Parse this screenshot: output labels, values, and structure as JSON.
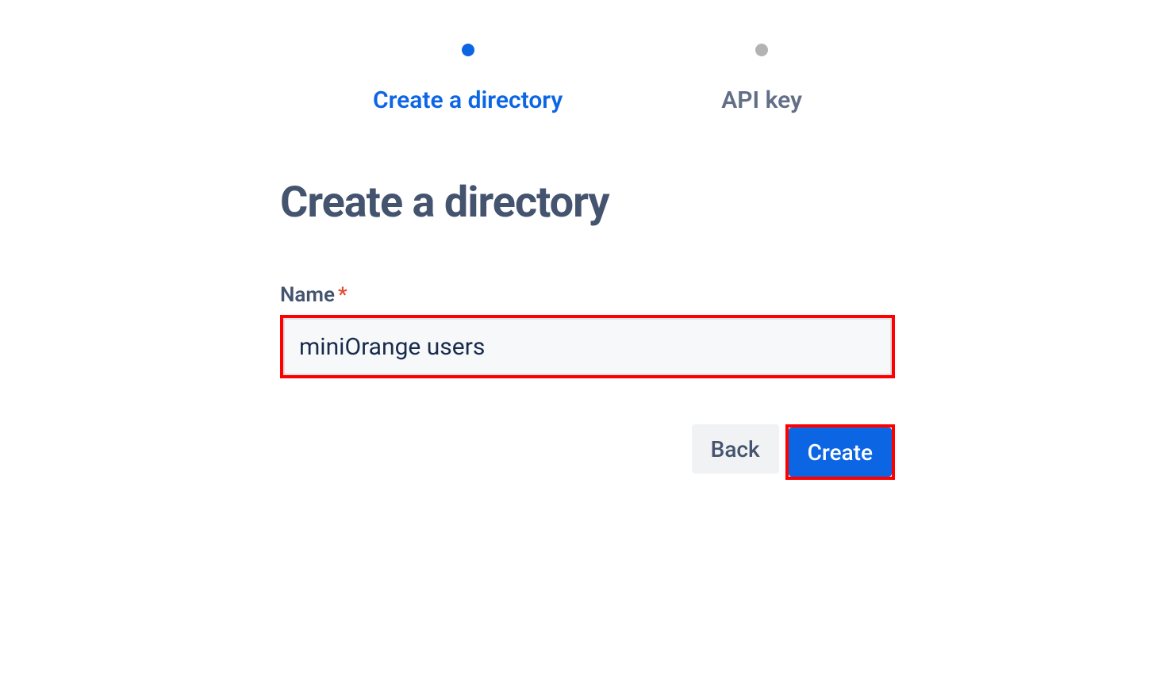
{
  "stepper": {
    "steps": [
      {
        "label": "Create a directory",
        "active": true
      },
      {
        "label": "API key",
        "active": false
      }
    ]
  },
  "page": {
    "title": "Create a directory"
  },
  "form": {
    "name_label": "Name",
    "required_mark": "*",
    "name_value": "miniOrange users"
  },
  "buttons": {
    "back_label": "Back",
    "create_label": "Create"
  }
}
